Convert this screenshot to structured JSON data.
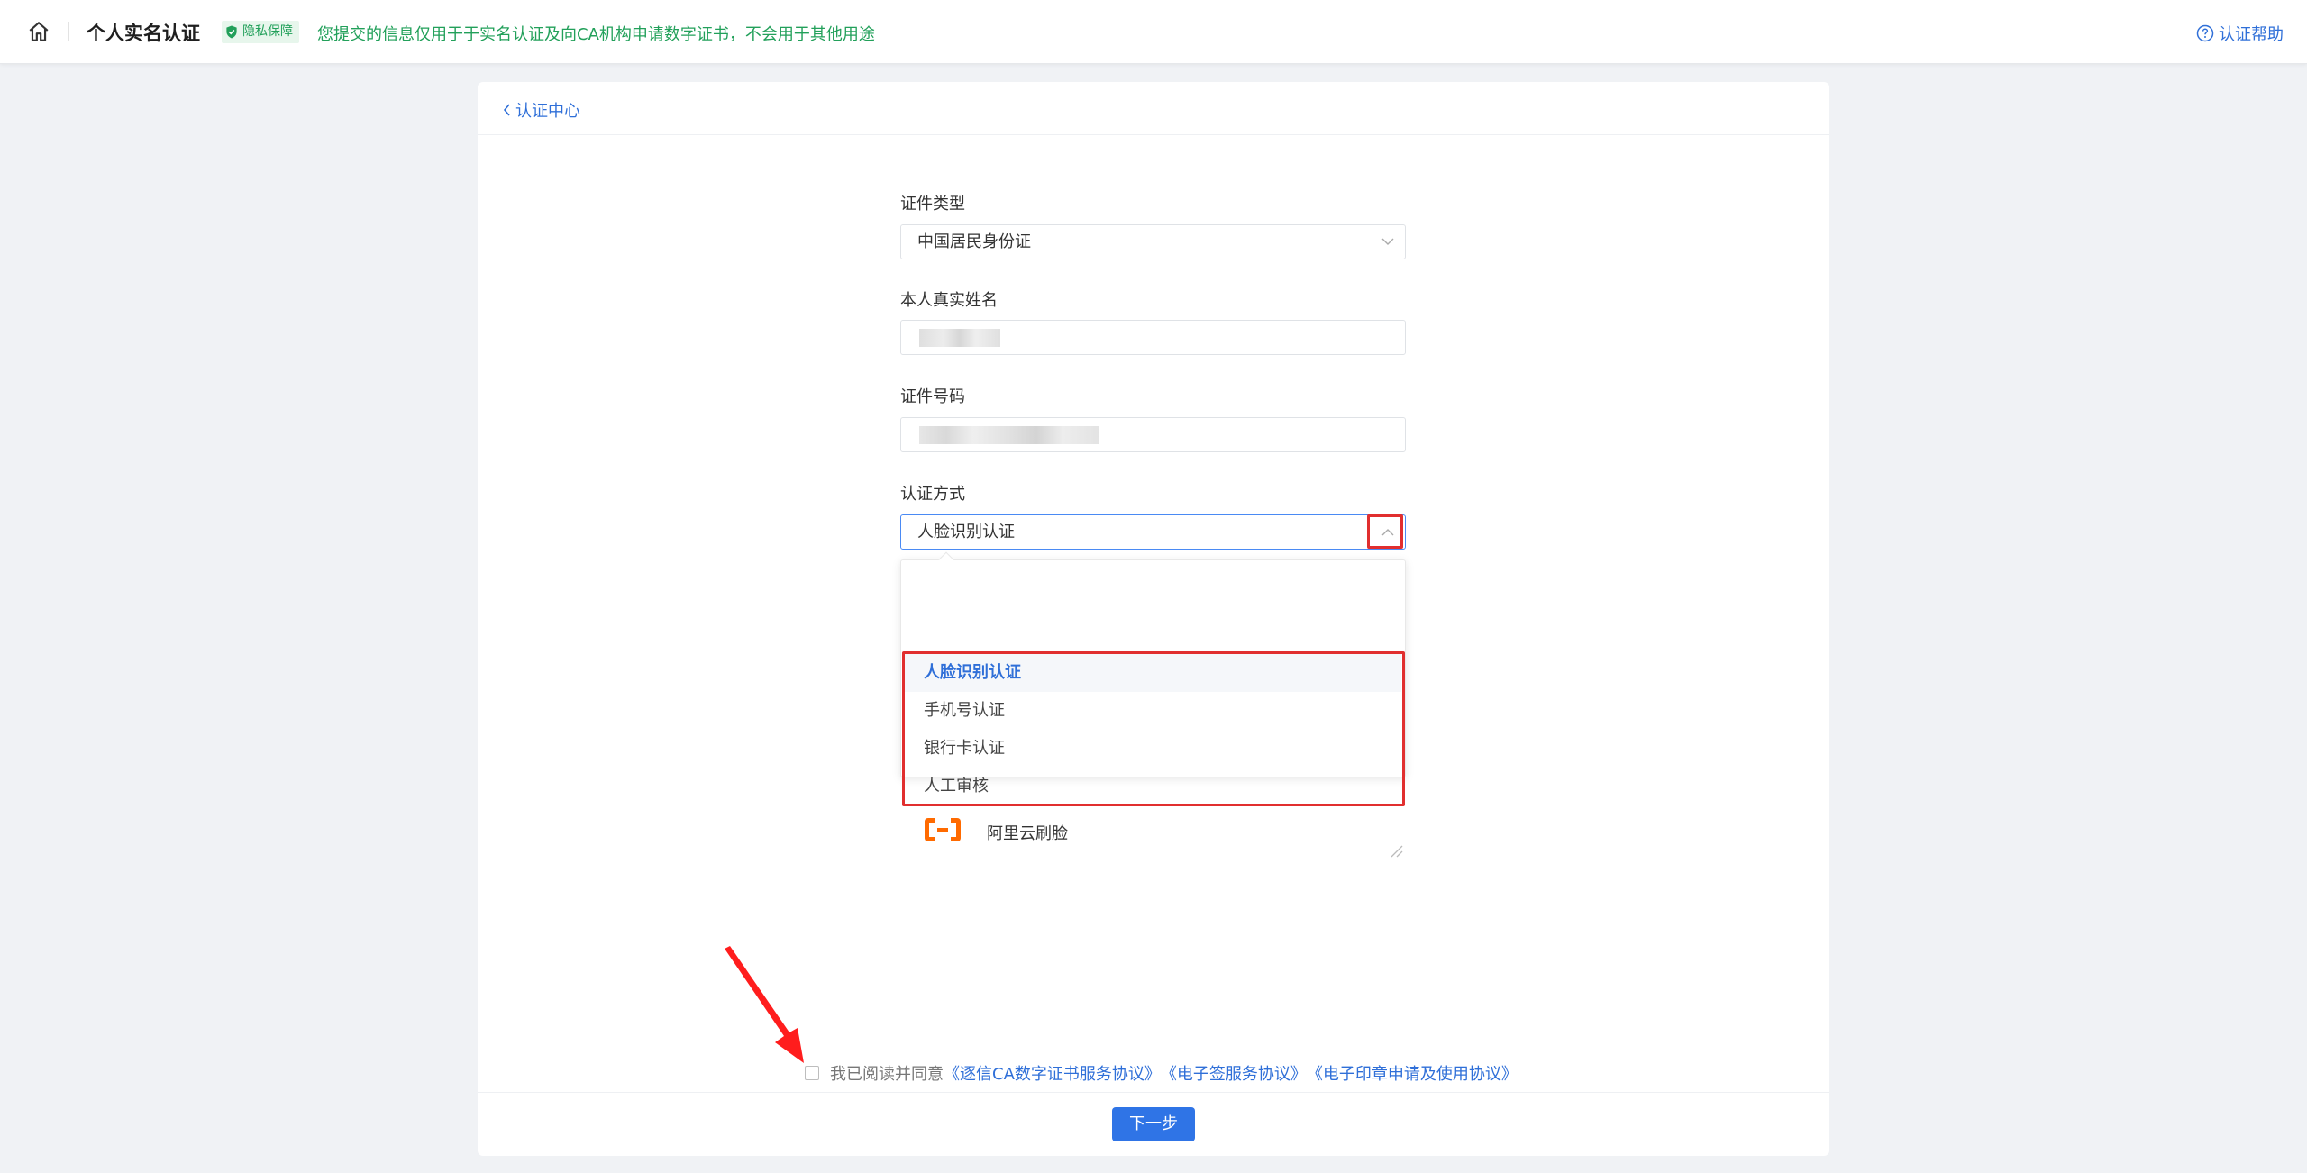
{
  "header": {
    "title": "个人实名认证",
    "privacy_badge": "隐私保障",
    "privacy_text": "您提交的信息仅用于于实名认证及向CA机构申请数字证书，不会用于其他用途",
    "help_label": "认证帮助"
  },
  "card": {
    "back_label": "认证中心"
  },
  "form": {
    "id_type": {
      "label": "证件类型",
      "value": "中国居民身份证"
    },
    "real_name": {
      "label": "本人真实姓名"
    },
    "id_number": {
      "label": "证件号码"
    },
    "method": {
      "label": "认证方式",
      "value": "人脸识别认证",
      "options": [
        "人脸识别认证",
        "手机号认证",
        "银行卡认证",
        "人工审核"
      ],
      "sub_option": "阿里云刷脸"
    }
  },
  "agreement": {
    "prefix": "我已阅读并同意",
    "links": [
      "《逐信CA数字证书服务协议》",
      "《电子签服务协议》",
      "《电子印章申请及使用协议》"
    ]
  },
  "next_button": "下一步",
  "colors": {
    "accent": "#2f74e6",
    "link": "#2f6fd8",
    "privacy_green": "#22a05a",
    "highlight_red": "#e12f2f",
    "aliyun_orange": "#ff6a00"
  }
}
